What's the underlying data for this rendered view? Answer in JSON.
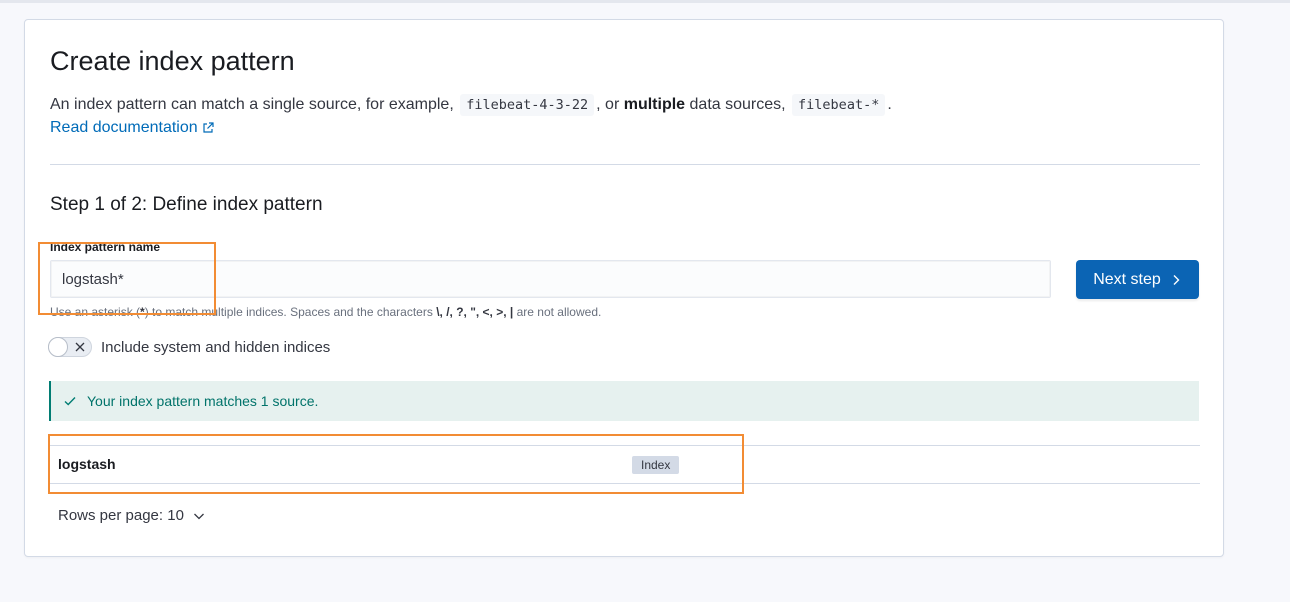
{
  "page": {
    "title": "Create index pattern",
    "description": {
      "part1": "An index pattern can match a single source, for example,",
      "code1": "filebeat-4-3-22",
      "part2": ", or",
      "bold": "multiple",
      "part3": "data sources,",
      "code2": "filebeat-*",
      "part4": "."
    },
    "doc_link": "Read documentation"
  },
  "step": {
    "title": "Step 1 of 2: Define index pattern",
    "field_label": "Index pattern name",
    "field_value": "logstash*",
    "help": {
      "prefix": "Use an asterisk (",
      "asterisk": "*",
      "middle": ") to match multiple indices. Spaces and the characters",
      "chars": "\\, /, ?, \", <, >, |",
      "suffix": "are not allowed."
    },
    "next_button": "Next step",
    "toggle_label": "Include system and hidden indices",
    "toggle_on": false
  },
  "callout": {
    "message": "Your index pattern matches 1 source."
  },
  "matches": {
    "rows": [
      {
        "name": "logstash",
        "type": "Index"
      }
    ],
    "rows_per_page": "Rows per page: 10"
  },
  "colors": {
    "primary": "#0b64b4",
    "success": "#017d73",
    "highlight": "#f28c34"
  }
}
